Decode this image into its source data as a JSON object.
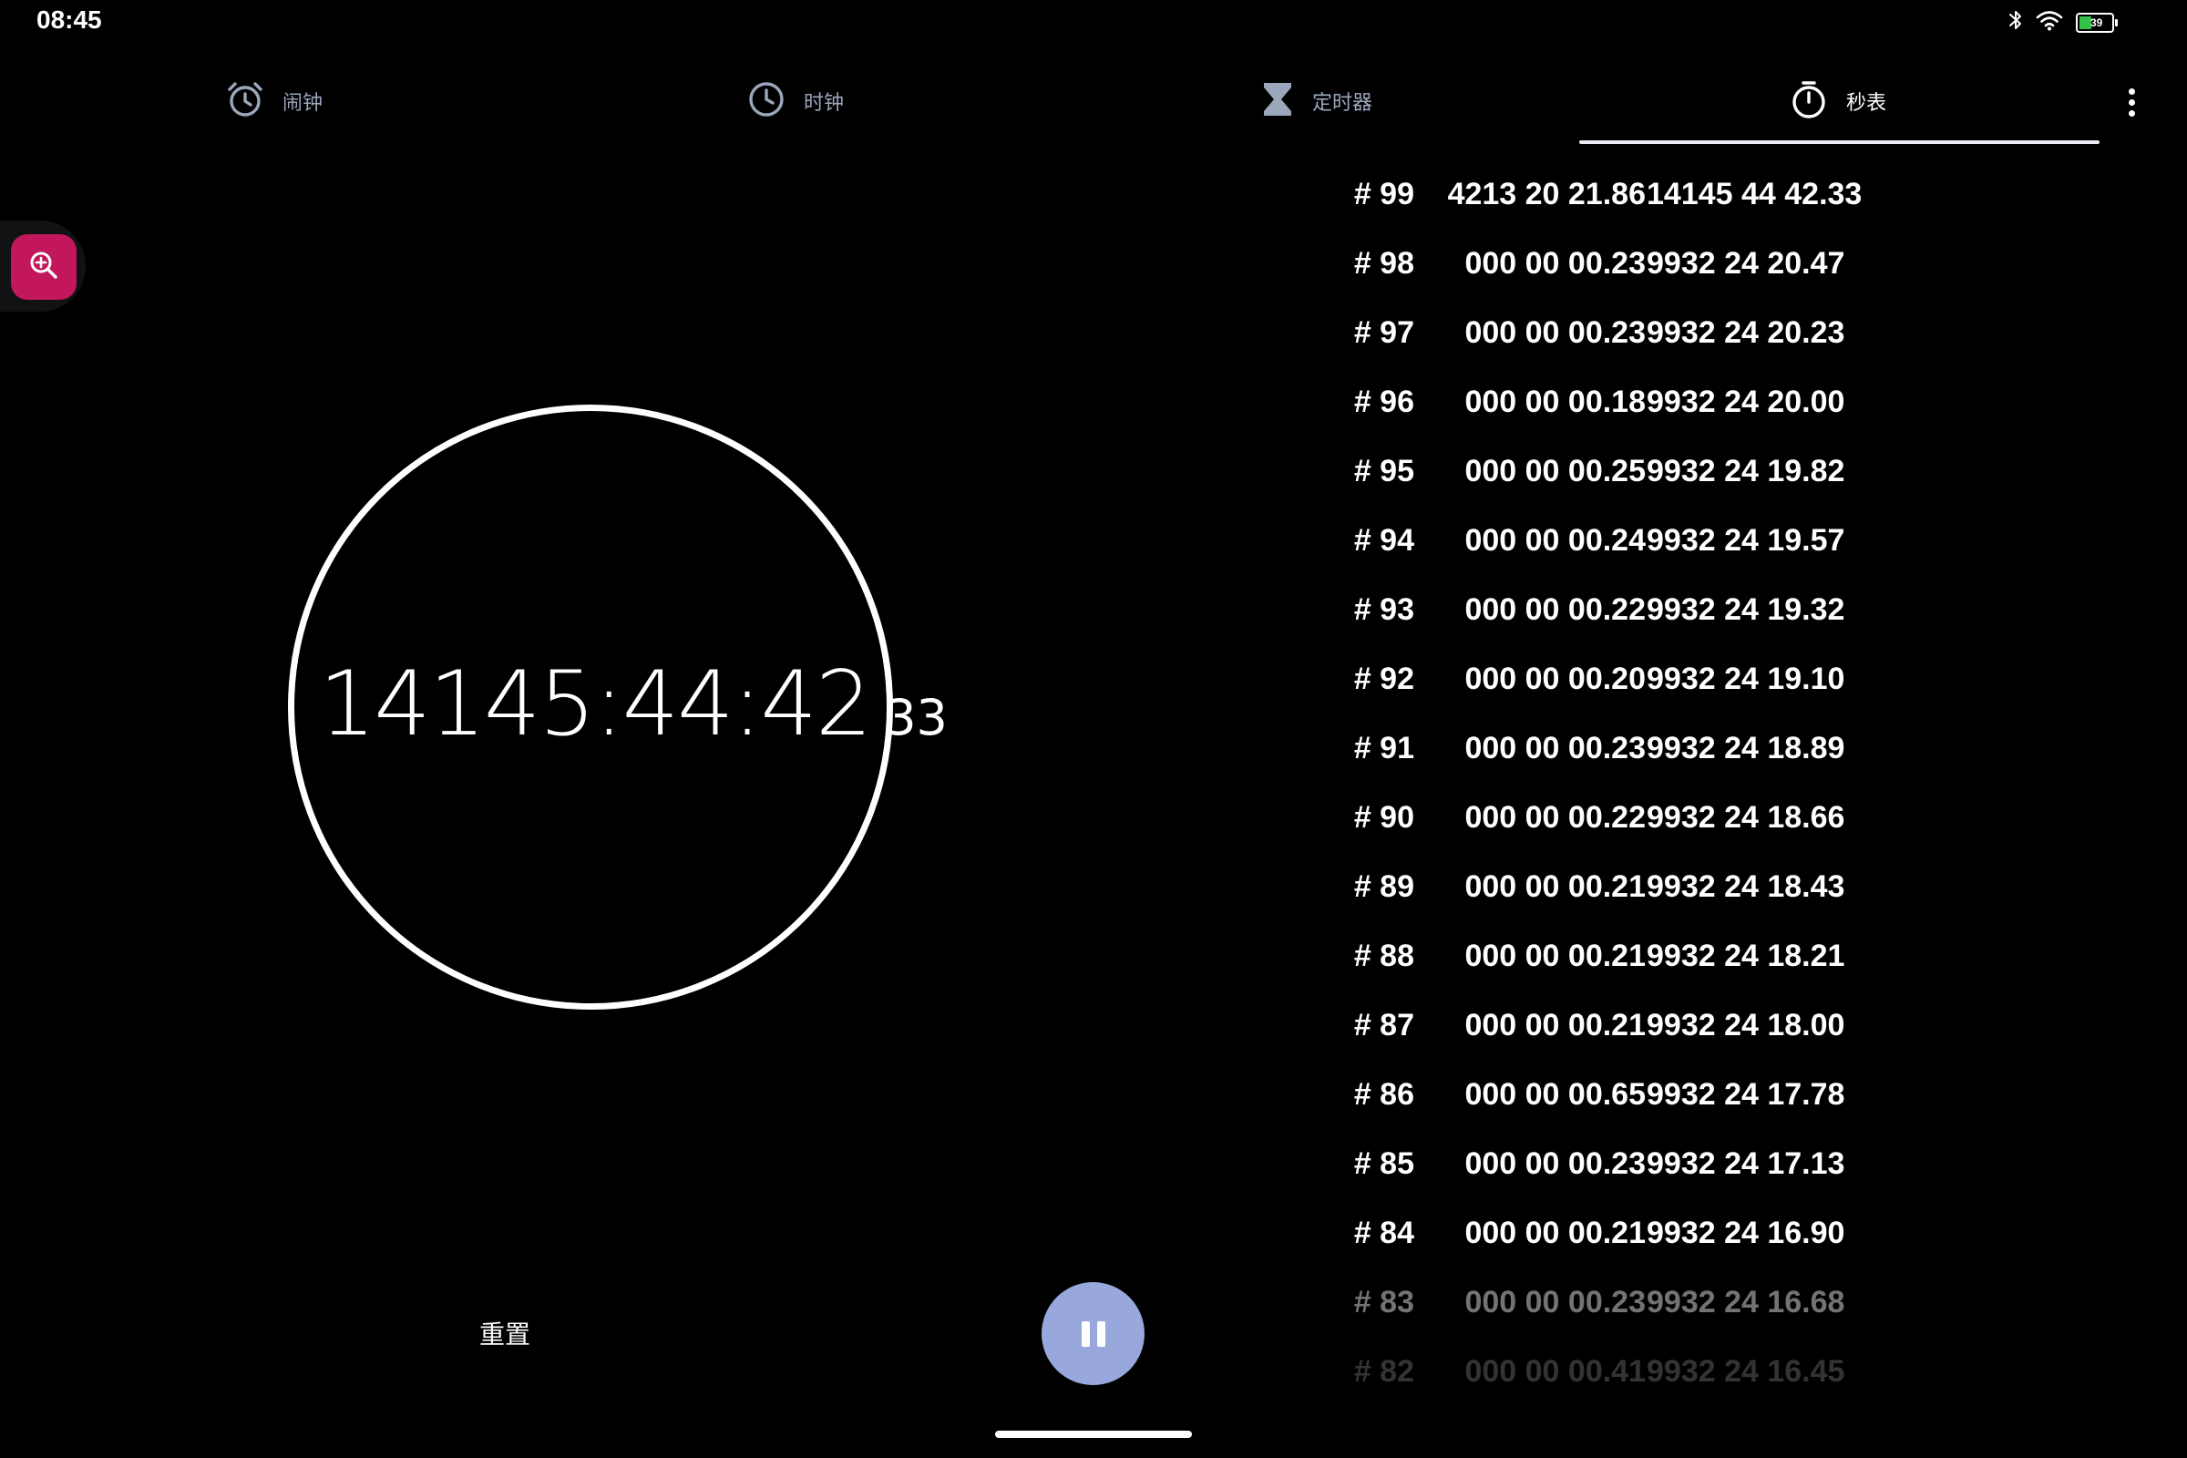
{
  "status_bar": {
    "time": "08:45",
    "battery_level": "39",
    "battery_fraction": 0.39,
    "icons": [
      "bluetooth-icon",
      "wifi-icon",
      "battery-icon"
    ],
    "battery_color": "#35c24b"
  },
  "tabs": [
    {
      "label": "闹钟",
      "icon": "alarm-clock-icon",
      "active": false
    },
    {
      "label": "时钟",
      "icon": "clock-icon",
      "active": false
    },
    {
      "label": "定时器",
      "icon": "hourglass-icon",
      "active": false
    },
    {
      "label": "秒表",
      "icon": "stopwatch-icon",
      "active": true
    }
  ],
  "stopwatch": {
    "elapsed_main": "14145:44:42",
    "elapsed_hundredths": "33"
  },
  "controls": {
    "reset_label": "重置",
    "pause_icon": "pause-icon",
    "pause_color": "#98a8dc"
  },
  "zoom": {
    "icon": "zoom-in-icon",
    "color": "#c2185b"
  },
  "laps": [
    {
      "num": "# 99",
      "split": "4213 20 21.86",
      "total": "14145 44 42.33"
    },
    {
      "num": "# 98",
      "split": "000 00 00.23",
      "total": "9932 24 20.47"
    },
    {
      "num": "# 97",
      "split": "000 00 00.23",
      "total": "9932 24 20.23"
    },
    {
      "num": "# 96",
      "split": "000 00 00.18",
      "total": "9932 24 20.00"
    },
    {
      "num": "# 95",
      "split": "000 00 00.25",
      "total": "9932 24 19.82"
    },
    {
      "num": "# 94",
      "split": "000 00 00.24",
      "total": "9932 24 19.57"
    },
    {
      "num": "# 93",
      "split": "000 00 00.22",
      "total": "9932 24 19.32"
    },
    {
      "num": "# 92",
      "split": "000 00 00.20",
      "total": "9932 24 19.10"
    },
    {
      "num": "# 91",
      "split": "000 00 00.23",
      "total": "9932 24 18.89"
    },
    {
      "num": "# 90",
      "split": "000 00 00.22",
      "total": "9932 24 18.66"
    },
    {
      "num": "# 89",
      "split": "000 00 00.21",
      "total": "9932 24 18.43"
    },
    {
      "num": "# 88",
      "split": "000 00 00.21",
      "total": "9932 24 18.21"
    },
    {
      "num": "# 87",
      "split": "000 00 00.21",
      "total": "9932 24 18.00"
    },
    {
      "num": "# 86",
      "split": "000 00 00.65",
      "total": "9932 24 17.78"
    },
    {
      "num": "# 85",
      "split": "000 00 00.23",
      "total": "9932 24 17.13"
    },
    {
      "num": "# 84",
      "split": "000 00 00.21",
      "total": "9932 24 16.90"
    },
    {
      "num": "# 83",
      "split": "000 00 00.23",
      "total": "9932 24 16.68"
    },
    {
      "num": "# 82",
      "split": "000 00 00.41",
      "total": "9932 24 16.45"
    }
  ]
}
